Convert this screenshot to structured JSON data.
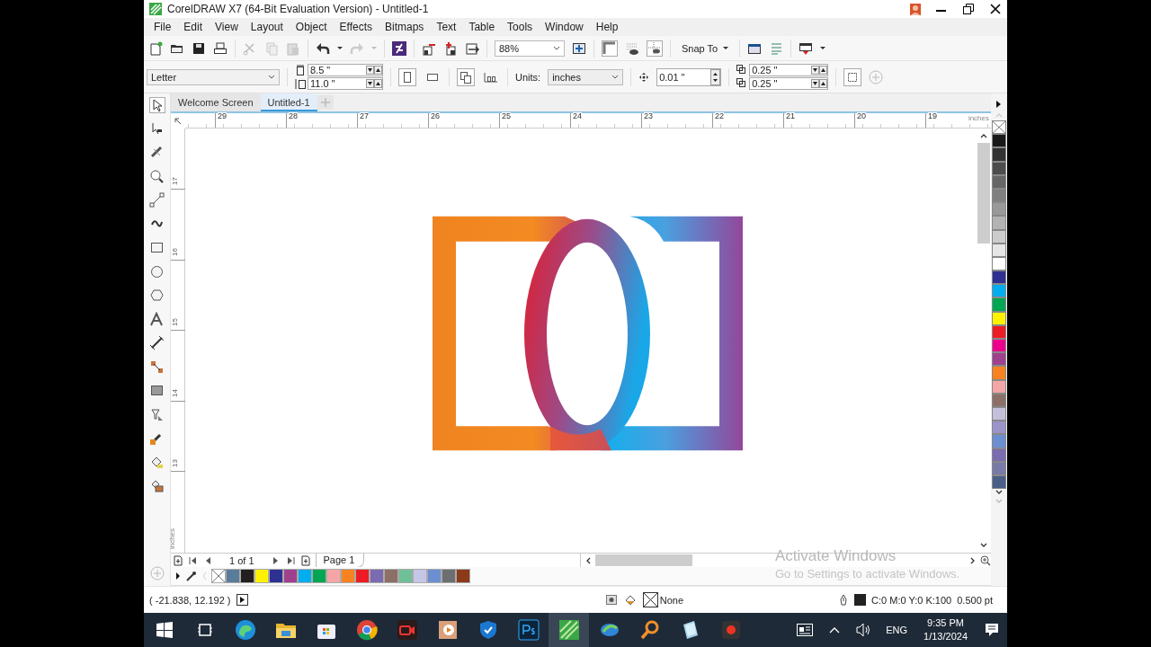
{
  "window": {
    "title": "CorelDRAW X7 (64-Bit Evaluation Version) - Untitled-1"
  },
  "menu": [
    "File",
    "Edit",
    "View",
    "Layout",
    "Object",
    "Effects",
    "Bitmaps",
    "Text",
    "Table",
    "Tools",
    "Window",
    "Help"
  ],
  "toolbar": {
    "zoom": "88%",
    "snap_to": "Snap To"
  },
  "property_bar": {
    "page_size": "Letter",
    "width": "8.5 \"",
    "height": "11.0 \"",
    "units_label": "Units:",
    "units": "inches",
    "nudge": "0.01 \"",
    "duplicate_x": "0.25 \"",
    "duplicate_y": "0.25 \""
  },
  "doc_tabs": [
    {
      "label": "Welcome Screen",
      "selected": false
    },
    {
      "label": "Untitled-1",
      "selected": true
    }
  ],
  "rulers": {
    "horizontal": [
      "29",
      "28",
      "27",
      "26",
      "25",
      "24",
      "23",
      "22",
      "21",
      "20",
      "19"
    ],
    "horizontal_unit": "inches",
    "vertical": [
      "17",
      "16",
      "15",
      "14",
      "13"
    ],
    "vertical_unit": "inches"
  },
  "page_nav": {
    "counter": "1 of 1",
    "page_tab": "Page 1"
  },
  "document_palette": [
    {
      "kind": "none"
    },
    {
      "kind": "color",
      "color": "#5b7b9b"
    },
    {
      "kind": "color",
      "color": "#231f20"
    },
    {
      "kind": "color",
      "color": "#fff200"
    },
    {
      "kind": "color",
      "color": "#2e3192"
    },
    {
      "kind": "color",
      "color": "#a0418f"
    },
    {
      "kind": "color",
      "color": "#00aeef"
    },
    {
      "kind": "color",
      "color": "#00a651"
    },
    {
      "kind": "color",
      "color": "#f4a6a6"
    },
    {
      "kind": "color",
      "color": "#f7821f"
    },
    {
      "kind": "color",
      "color": "#ed1c24"
    },
    {
      "kind": "color",
      "color": "#7b6bb0"
    },
    {
      "kind": "color",
      "color": "#8c7067"
    },
    {
      "kind": "color",
      "color": "#6fbf99"
    },
    {
      "kind": "color",
      "color": "#c6c6e6"
    },
    {
      "kind": "color",
      "color": "#6b8fd0"
    },
    {
      "kind": "color",
      "color": "#6d6e71"
    },
    {
      "kind": "color",
      "color": "#8b3a1a"
    }
  ],
  "color_palette": [
    {
      "kind": "none"
    },
    {
      "kind": "color",
      "color": "#1a1a1a"
    },
    {
      "kind": "color",
      "color": "#333333"
    },
    {
      "kind": "color",
      "color": "#4d4d4d"
    },
    {
      "kind": "color",
      "color": "#666666"
    },
    {
      "kind": "color",
      "color": "#808080"
    },
    {
      "kind": "color",
      "color": "#999999"
    },
    {
      "kind": "color",
      "color": "#b3b3b3"
    },
    {
      "kind": "color",
      "color": "#cccccc"
    },
    {
      "kind": "color",
      "color": "#e6e6e6"
    },
    {
      "kind": "color",
      "color": "#ffffff"
    },
    {
      "kind": "color",
      "color": "#2e3192"
    },
    {
      "kind": "color",
      "color": "#00aeef"
    },
    {
      "kind": "color",
      "color": "#00a651"
    },
    {
      "kind": "color",
      "color": "#fff200"
    },
    {
      "kind": "color",
      "color": "#ed1c24"
    },
    {
      "kind": "color",
      "color": "#ec008c"
    },
    {
      "kind": "color",
      "color": "#a0418f"
    },
    {
      "kind": "color",
      "color": "#f7821f"
    },
    {
      "kind": "color",
      "color": "#f4a6a6"
    },
    {
      "kind": "color",
      "color": "#8c7067"
    },
    {
      "kind": "color",
      "color": "#c4c0dc"
    },
    {
      "kind": "color",
      "color": "#9a94c8"
    },
    {
      "kind": "color",
      "color": "#6b8fd0"
    },
    {
      "kind": "color",
      "color": "#7b6bb0"
    },
    {
      "kind": "color",
      "color": "#7a7aa8"
    },
    {
      "kind": "color",
      "color": "#4a5f88"
    }
  ],
  "status": {
    "coordinates": "( -21.838, 12.192 )",
    "fill": "None",
    "outline": "C:0 M:0 Y:0 K:100  0.500 pt"
  },
  "activation_notice": {
    "title": "Activate Windows",
    "subtitle": "Go to Settings to activate Windows."
  },
  "taskbar": {
    "language": "ENG",
    "time": "9:35 PM",
    "date": "1/13/2024"
  }
}
